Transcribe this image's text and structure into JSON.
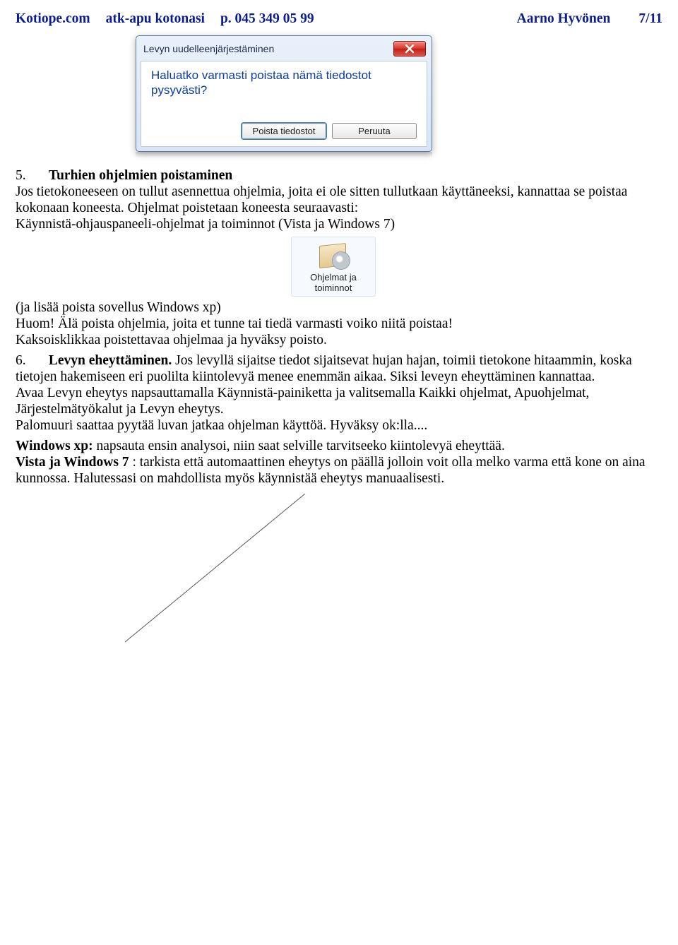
{
  "header": {
    "site": "Kotiope.com",
    "tagline": "atk-apu kotonasi",
    "phone": "p. 045 349 05 99",
    "author": "Aarno Hyvönen",
    "pagenum": "7/11"
  },
  "dialog": {
    "title": "Levyn uudelleenjärjestäminen",
    "message_l1": "Haluatko varmasti poistaa nämä tiedostot",
    "message_l2": "pysyvästi?",
    "btn_ok": "Poista tiedostot",
    "btn_cancel": "Peruuta"
  },
  "section5": {
    "num": "5.",
    "title": "Turhien ohjelmien poistaminen",
    "p1": "Jos tietokoneeseen on tullut asennettua ohjelmia, joita ei ole sitten tullutkaan käyttäneeksi, kannattaa se poistaa kokonaan koneesta. Ohjelmat poistetaan koneesta seuraavasti:",
    "p2": "Käynnistä-ohjauspaneeli-ohjelmat ja toiminnot (Vista ja Windows 7)",
    "cp_label_l1": "Ohjelmat ja",
    "cp_label_l2": "toiminnot",
    "p3": "(ja lisää poista sovellus Windows xp)",
    "p4": "Huom! Älä poista ohjelmia, joita et tunne tai tiedä varmasti voiko niitä  poistaa!",
    "p5": "Kaksoisklikkaa poistettavaa ohjelmaa ja hyväksy poisto."
  },
  "section6": {
    "num": "6.",
    "title": "Levyn eheyttäminen.",
    "rest1": " Jos levyllä sijaitse tiedot sijaitsevat hujan hajan,  toimii tietokone hitaammin, koska tietojen hakemiseen eri puolilta kiintolevyä menee enemmän aikaa. Siksi leveyn eheyttäminen kannattaa.",
    "p2": "Avaa Levyn eheytys napsauttamalla Käynnistä-painiketta  ja valitsemalla Kaikki ohjelmat, Apuohjelmat, Järjestelmätyökalut ja Levyn eheytys.",
    "p3": "Palomuuri saattaa pyytää luvan jatkaa ohjelman käyttöä. Hyväksy ok:lla....",
    "xp_label": "Windows xp:",
    "xp_rest": "   napsauta ensin analysoi, niin saat selville tarvitseeko kiintolevyä eheyttää.",
    "w7_label": "Vista ja Windows 7",
    "w7_rest": ": tarkista että automaattinen eheytys on päällä jolloin voit olla melko varma että kone on aina  kunnossa. Halutessasi on mahdollista myös käynnistää eheytys manuaalisesti."
  }
}
